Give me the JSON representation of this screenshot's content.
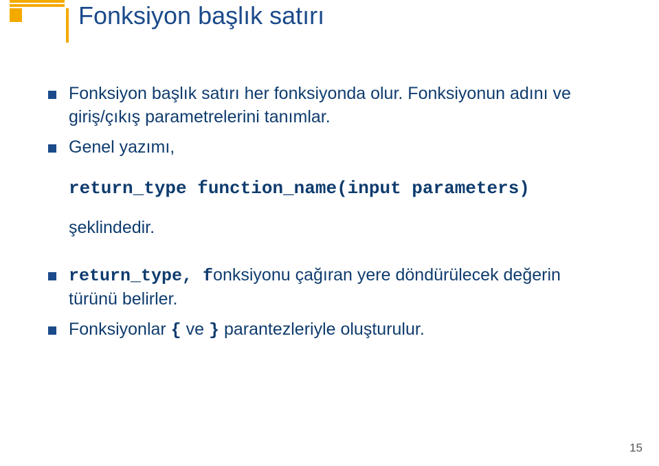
{
  "title": "Fonksiyon başlık satırı",
  "bullets": {
    "b1a": "Fonksiyon başlık satırı her fonksiyonda olur. Fonksiyonun adını ve giriş/çıkış parametrelerini tanımlar.",
    "b2": "Genel yazımı,",
    "b3_pre": "return_type, f",
    "b3_post": "onksiyonu çağıran yere döndürülecek değerin türünü belirler.",
    "b4_a": "Fonksiyonlar ",
    "b4_b": "{",
    "b4_c": " ve ",
    "b4_d": "}",
    "b4_e": " parantezleriyle oluşturulur."
  },
  "code": "return_type function_name(input parameters)",
  "indent": "şeklindedir.",
  "page": "15"
}
